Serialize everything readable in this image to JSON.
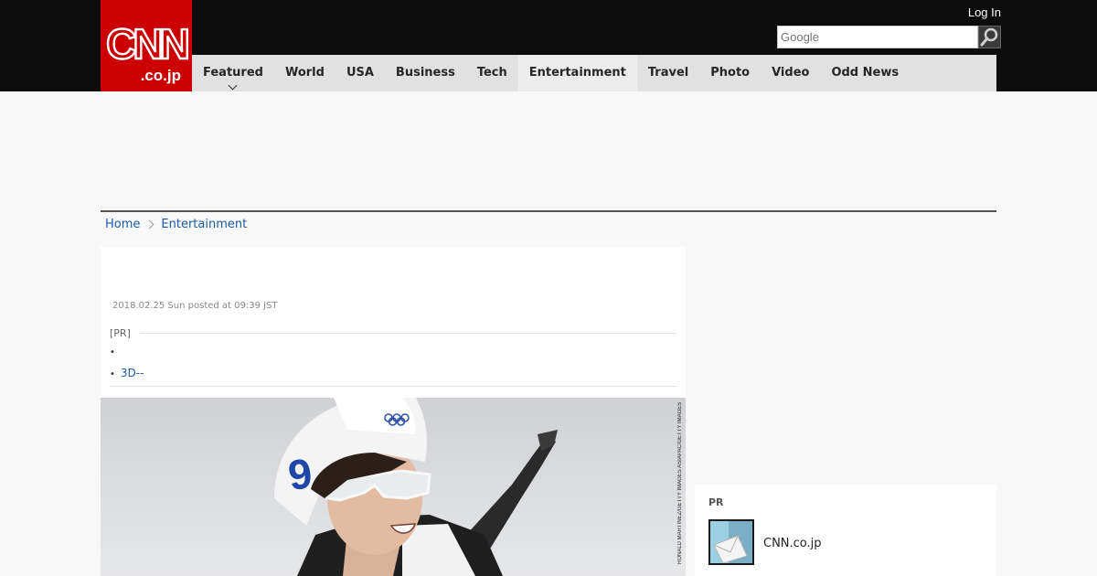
{
  "header": {
    "logo": {
      "line1": "CNN",
      "line2": ".co.jp"
    },
    "login_label": "Log In",
    "search": {
      "placeholder": "Google"
    }
  },
  "nav": {
    "items": [
      {
        "label": "Featured"
      },
      {
        "label": "World"
      },
      {
        "label": "USA"
      },
      {
        "label": "Business"
      },
      {
        "label": "Tech"
      },
      {
        "label": "Entertainment"
      },
      {
        "label": "Travel"
      },
      {
        "label": "Photo"
      },
      {
        "label": "Video"
      },
      {
        "label": "Odd News"
      }
    ]
  },
  "breadcrumb": {
    "home": "Home",
    "section": "Entertainment"
  },
  "article": {
    "timestamp": "2018.02.25 Sun posted at 09:39 JST",
    "pr_label": "[PR]",
    "pr_links": [
      "",
      "3D--"
    ],
    "photo_credit": "RONALD MARTINEZ/GETTY IMAGES ASIAPAC/GETTY IMAGES"
  },
  "sidebar": {
    "pr_title": "PR",
    "pr_item_label": "CNN.co.jp"
  },
  "colors": {
    "brand_red": "#cc0000",
    "topbar": "#0c0c0c",
    "nav_bg": "#e1e1e1",
    "link": "#1a5aa6"
  }
}
